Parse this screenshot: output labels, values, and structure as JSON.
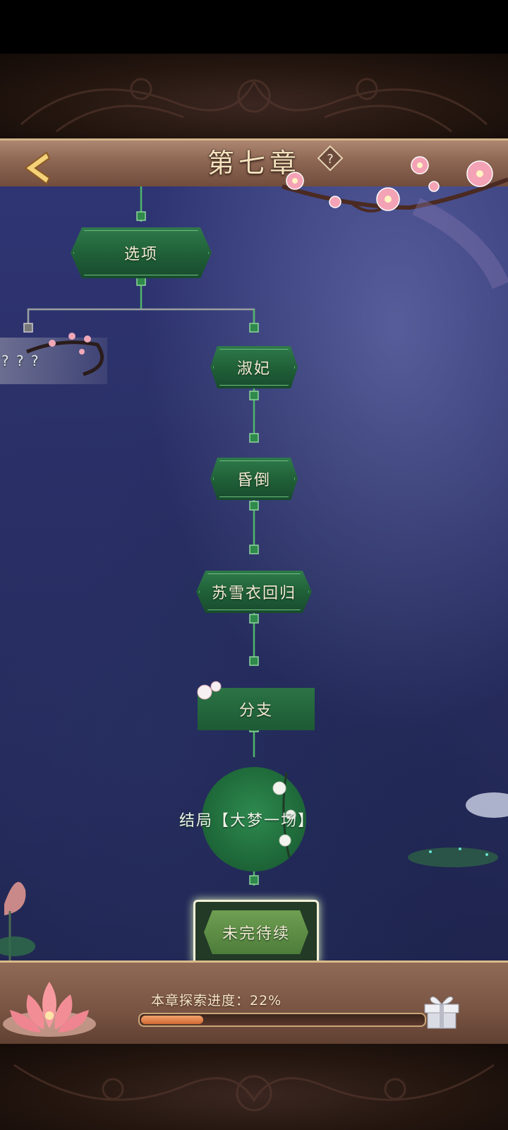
{
  "header": {
    "title": "第七章",
    "help_glyph": "?"
  },
  "tree": {
    "nodes": [
      {
        "id": "option",
        "label": "选项"
      },
      {
        "id": "locked",
        "label": "? ? ?"
      },
      {
        "id": "shufei",
        "label": "淑妃"
      },
      {
        "id": "faint",
        "label": "昏倒"
      },
      {
        "id": "return",
        "label": "苏雪衣回归"
      },
      {
        "id": "branch",
        "label": "分支"
      },
      {
        "id": "ending",
        "label": "结局【大梦一场】"
      },
      {
        "id": "tbc",
        "label": "未完待续"
      }
    ]
  },
  "progress": {
    "label": "本章探索进度：22%",
    "value": 0.22
  },
  "colors": {
    "node_green": "#1f5e37",
    "sky": "#2b3068",
    "wood": "#8d6652",
    "gold": "#d7b98a"
  },
  "icons": {
    "back": "chevron-left-icon",
    "help": "question-icon",
    "gift": "gift-icon"
  }
}
